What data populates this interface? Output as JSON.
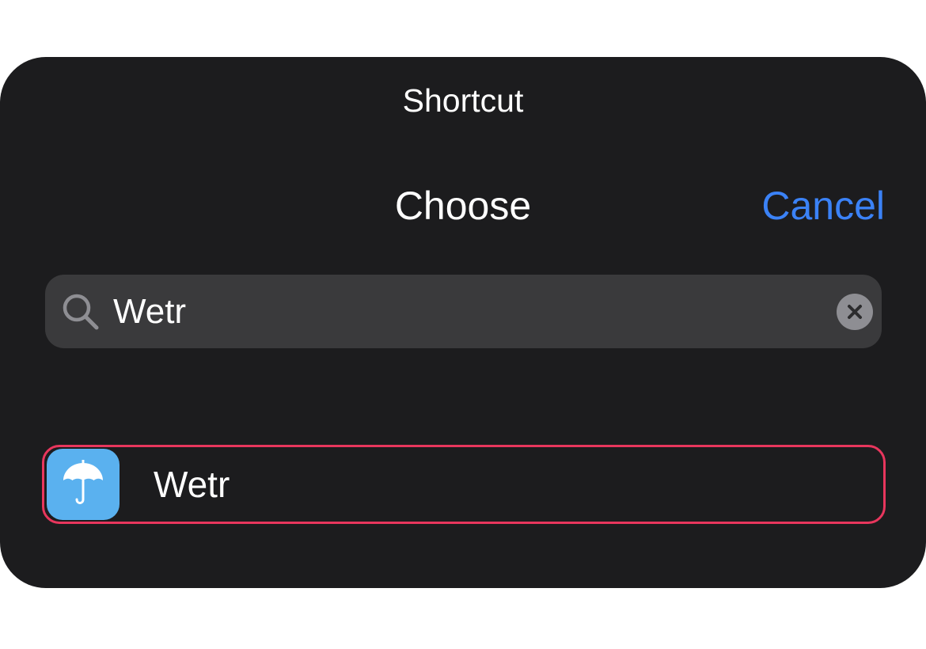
{
  "sheet": {
    "title": "Shortcut"
  },
  "nav": {
    "title": "Choose",
    "cancel_label": "Cancel"
  },
  "search": {
    "value": "Wetr",
    "icon": "search-icon",
    "clear_icon": "clear-icon"
  },
  "results": [
    {
      "label": "Wetr",
      "icon": "umbrella-icon",
      "icon_color": "#5ab1ef",
      "highlighted": true
    }
  ],
  "colors": {
    "background": "#1c1c1e",
    "accent": "#3b82f6",
    "highlight": "#e8365d",
    "search_field": "#3a3a3c"
  }
}
